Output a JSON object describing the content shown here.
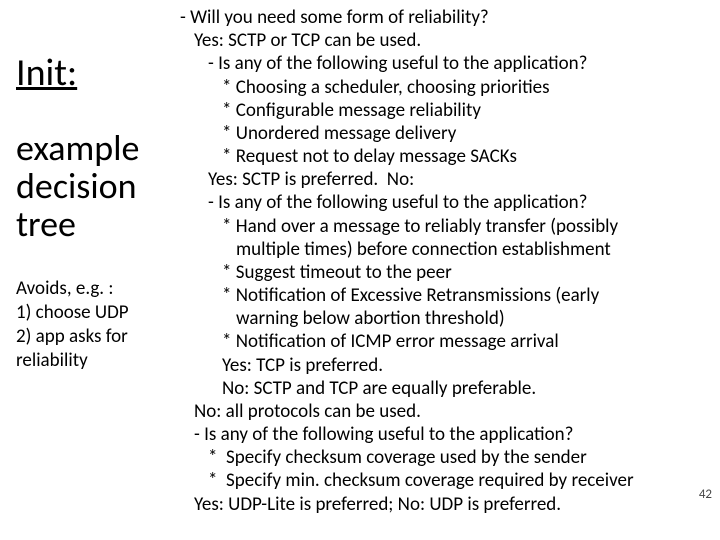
{
  "left": {
    "init": "Init:",
    "example": "example decision tree",
    "avoids_l1": "Avoids, e.g. :",
    "avoids_l2": "1) choose UDP",
    "avoids_l3": "2) app asks for",
    "avoids_l4": "reliability"
  },
  "lines": {
    "l01": "- Will you need some form of reliability?",
    "l02": "Yes: SCTP or TCP can be used.",
    "l03": "- Is any of the following useful to the application?",
    "l04": "* Choosing a scheduler, choosing priorities",
    "l05": "* Configurable message reliability",
    "l06": "* Unordered message delivery",
    "l07": "* Request not to delay message SACKs",
    "l08": "Yes: SCTP is preferred.  No:",
    "l09": "- Is any of the following useful to the application?",
    "l10": "* Hand over a message to reliably transfer (possibly",
    "l11": "multiple times) before connection establishment",
    "l12": "* Suggest timeout to the peer",
    "l13": "* Notification of Excessive Retransmissions (early",
    "l14": "warning below abortion threshold)",
    "l15": "* Notification of ICMP error message arrival",
    "l16": "Yes: TCP is preferred.",
    "l17": "No: SCTP and TCP are equally preferable.",
    "l18": "No: all protocols can be used.",
    "l19": "- Is any of the following useful to the application?",
    "l20": "*  Specify checksum coverage used by the sender",
    "l21": "*  Specify min. checksum coverage required by receiver",
    "l22": "Yes: UDP-Lite is preferred; No: UDP is preferred."
  },
  "pagenum": "42"
}
